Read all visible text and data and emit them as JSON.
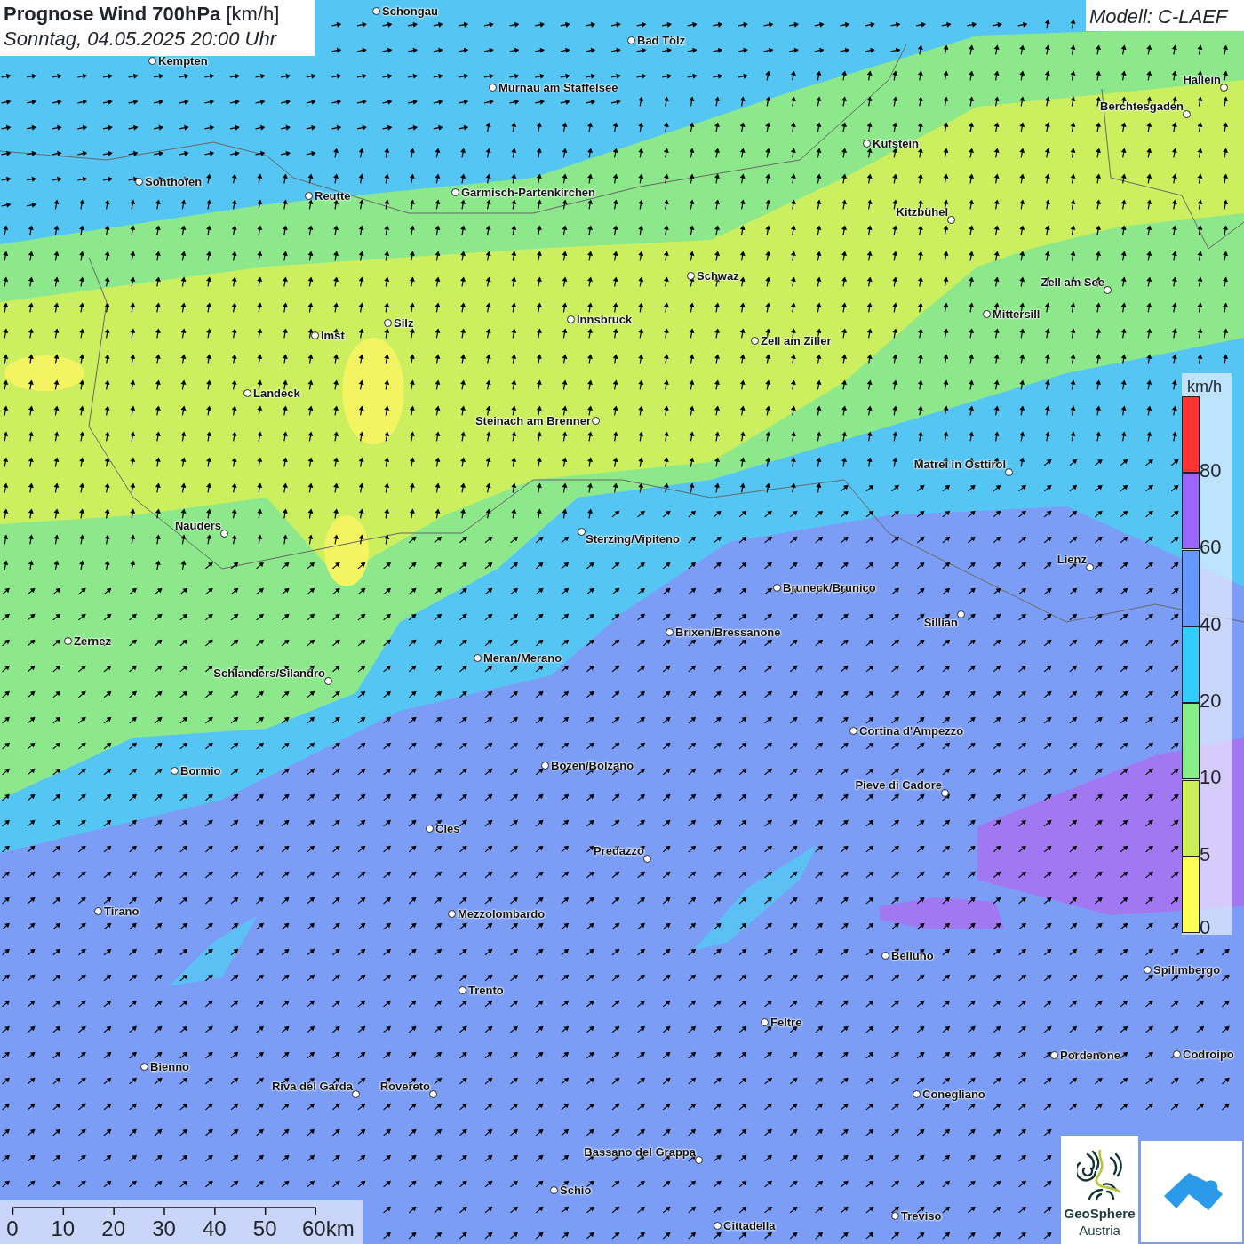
{
  "title": {
    "heading": "**Prognose Wind 700hPa** [km/h]",
    "subtitle": "Sonntag, 04.05.2025 20:00 Uhr"
  },
  "model": "Modell: C-LAEF",
  "cities": [
    {
      "name": "Schongau"
    },
    {
      "name": "Bad Tölz"
    },
    {
      "name": "Kempten"
    },
    {
      "name": "Murnau am Staffelsee"
    },
    {
      "name": "Hallein"
    },
    {
      "name": "Berchtesgaden"
    },
    {
      "name": "Kufstein"
    },
    {
      "name": "Sonthofen"
    },
    {
      "name": "Reutte"
    },
    {
      "name": "Garmisch-Partenkirchen"
    },
    {
      "name": "Kitzbühel"
    },
    {
      "name": "Schwaz"
    },
    {
      "name": "Zell am See"
    },
    {
      "name": "Mittersill"
    },
    {
      "name": "Innsbruck"
    },
    {
      "name": "Silz"
    },
    {
      "name": "Imst"
    },
    {
      "name": "Zell am Ziller"
    },
    {
      "name": "Landeck"
    },
    {
      "name": "Steinach am Brenner"
    },
    {
      "name": "Matrei in Osttirol"
    },
    {
      "name": "Nauders"
    },
    {
      "name": "Sterzing/Vipiteno"
    },
    {
      "name": "Lienz"
    },
    {
      "name": "Bruneck/Brunico"
    },
    {
      "name": "Sillian"
    },
    {
      "name": "Brixen/Bressanone"
    },
    {
      "name": "Zernez"
    },
    {
      "name": "Meran/Merano"
    },
    {
      "name": "Schlanders/Silandro"
    },
    {
      "name": "Cortina d'Ampezzo"
    },
    {
      "name": "Bozen/Bolzano"
    },
    {
      "name": "Bormio"
    },
    {
      "name": "Pieve di Cadore"
    },
    {
      "name": "Cles"
    },
    {
      "name": "Predazzo"
    },
    {
      "name": "Tirano"
    },
    {
      "name": "Mezzolombardo"
    },
    {
      "name": "Belluno"
    },
    {
      "name": "Spilimbergo"
    },
    {
      "name": "Trento"
    },
    {
      "name": "Feltre"
    },
    {
      "name": "Pordenone"
    },
    {
      "name": "Codroipo"
    },
    {
      "name": "Bienno"
    },
    {
      "name": "Riva del Garda"
    },
    {
      "name": "Rovereto"
    },
    {
      "name": "Conegliano"
    },
    {
      "name": "Bassano del Grappa"
    },
    {
      "name": "Schio"
    },
    {
      "name": "Treviso"
    },
    {
      "name": "Cittadella"
    }
  ],
  "legend": {
    "unit": "km/h",
    "bands": [
      {
        "label": "80",
        "color": "#ff3333"
      },
      {
        "label": "60",
        "color": "#9966ff"
      },
      {
        "label": "40",
        "color": "#6699ff"
      },
      {
        "label": "20",
        "color": "#33ccff"
      },
      {
        "label": "10",
        "color": "#88ee88"
      },
      {
        "label": "5",
        "color": "#ccee55"
      },
      {
        "label": "0",
        "color": "#ffff55"
      }
    ]
  },
  "scale_bar": {
    "ticks": [
      "0",
      "10",
      "20",
      "30",
      "40",
      "50",
      "60km"
    ]
  },
  "logos": {
    "geosphere_name": "GeoSphere",
    "geosphere_country": "Austria"
  }
}
